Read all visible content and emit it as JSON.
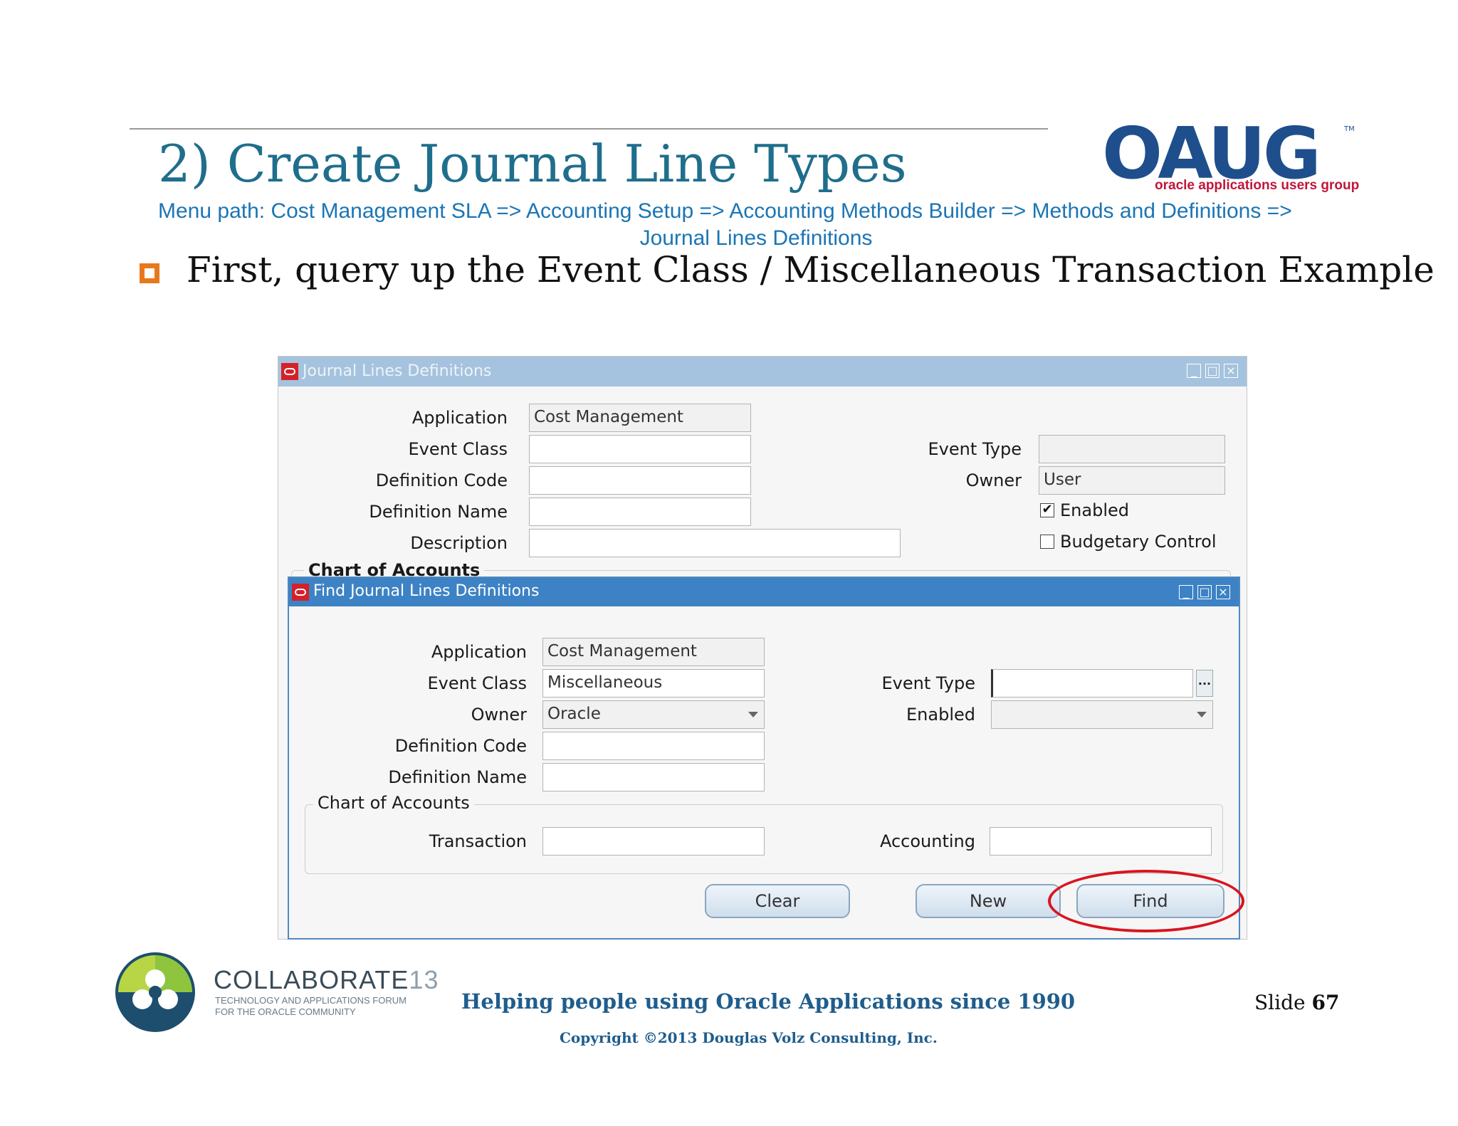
{
  "slide": {
    "title": "2) Create Journal Line Types",
    "menu_path_line1": "Menu path: Cost Management SLA => Accounting Setup => Accounting Methods Builder => Methods and Definitions =>",
    "menu_path_line2": "Journal Lines Definitions",
    "bullet": "First, query up the Event Class / Miscellaneous Transaction Example",
    "colors": {
      "title": "#1f6e8c",
      "menu_path": "#1b75b4",
      "bullet": "#e8781c",
      "highlight_oval": "#d8151f"
    }
  },
  "oaug_logo": {
    "letters": "OAUG",
    "tagline": "oracle applications users group",
    "tm": "TM"
  },
  "outer_window": {
    "title": "Journal Lines Definitions",
    "labels": {
      "application": "Application",
      "event_class": "Event Class",
      "definition_code": "Definition Code",
      "definition_name": "Definition Name",
      "description": "Description",
      "event_type": "Event Type",
      "owner": "Owner",
      "enabled": "Enabled",
      "budgetary_control": "Budgetary Control",
      "chart_of_accounts": "Chart of Accounts"
    },
    "values": {
      "application": "Cost Management",
      "event_class": "",
      "definition_code": "",
      "definition_name": "",
      "description": "",
      "event_type": "",
      "owner": "User",
      "enabled": "✔",
      "budgetary_control": ""
    },
    "buttons": {
      "minimize": "_",
      "maximize": "□",
      "close": "×"
    }
  },
  "find_window": {
    "title": "Find Journal Lines Definitions",
    "labels": {
      "application": "Application",
      "event_class": "Event Class",
      "owner": "Owner",
      "definition_code": "Definition Code",
      "definition_name": "Definition Name",
      "event_type": "Event Type",
      "enabled": "Enabled",
      "chart_of_accounts": "Chart of Accounts",
      "transaction": "Transaction",
      "accounting": "Accounting"
    },
    "values": {
      "application": "Cost Management",
      "event_class": "Miscellaneous",
      "owner": "Oracle",
      "definition_code": "",
      "definition_name": "",
      "event_type": "",
      "enabled": "",
      "transaction": "",
      "accounting": ""
    },
    "lov_button": "...",
    "buttons": {
      "clear": "Clear",
      "new": "New",
      "find": "Find"
    },
    "window_buttons": {
      "minimize": "_",
      "maximize": "□",
      "close": "×"
    }
  },
  "footer": {
    "collaborate_name": "COLLABORATE",
    "collaborate_number": "13",
    "collaborate_sub_line1": "TECHNOLOGY AND APPLICATIONS FORUM",
    "collaborate_sub_line2": "FOR THE ORACLE COMMUNITY",
    "slogan": "Helping people using Oracle Applications since 1990",
    "copyright": "Copyright ©2013 Douglas Volz Consulting, Inc.",
    "slide_label": "Slide",
    "slide_number": "67"
  }
}
